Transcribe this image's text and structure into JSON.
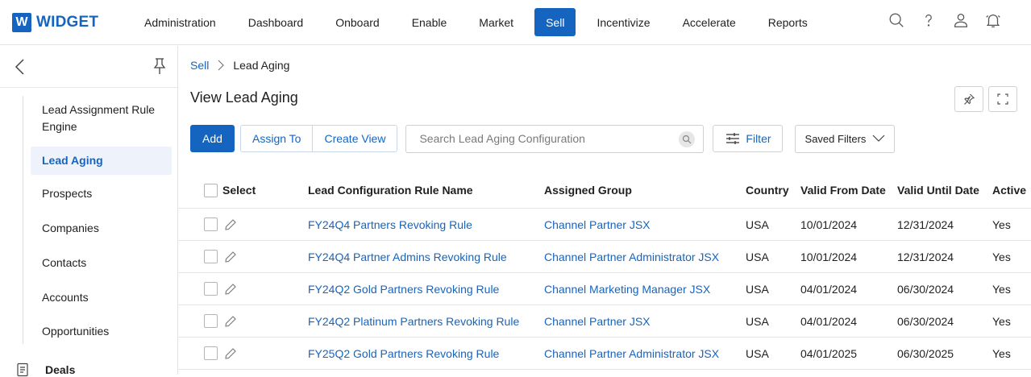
{
  "app": {
    "logo_letter": "W",
    "logo_text": "WIDGET"
  },
  "nav": {
    "items": [
      {
        "label": "Administration"
      },
      {
        "label": "Dashboard"
      },
      {
        "label": "Onboard"
      },
      {
        "label": "Enable"
      },
      {
        "label": "Market"
      },
      {
        "label": "Sell",
        "active": true
      },
      {
        "label": "Incentivize"
      },
      {
        "label": "Accelerate"
      },
      {
        "label": "Reports"
      }
    ],
    "icons": [
      "search-icon",
      "help-icon",
      "user-icon",
      "bell-icon"
    ]
  },
  "sidebar": {
    "items": [
      {
        "label": "Lead Assignment Rule Engine"
      },
      {
        "label": "Lead Aging",
        "active": true
      },
      {
        "label": "Prospects"
      },
      {
        "label": "Companies"
      },
      {
        "label": "Contacts"
      },
      {
        "label": "Accounts"
      },
      {
        "label": "Opportunities"
      }
    ],
    "deals_label": "Deals"
  },
  "breadcrumb": {
    "parent": "Sell",
    "current": "Lead Aging"
  },
  "page": {
    "title": "View Lead Aging"
  },
  "toolbar": {
    "add_label": "Add",
    "assign_label": "Assign To",
    "create_view_label": "Create View",
    "search_placeholder": "Search Lead Aging Configuration",
    "filter_label": "Filter",
    "saved_filters_label": "Saved Filters"
  },
  "table": {
    "headers": {
      "select": "Select",
      "name": "Lead Configuration Rule Name",
      "group": "Assigned Group",
      "country": "Country",
      "from": "Valid From Date",
      "until": "Valid Until Date",
      "active": "Active"
    },
    "rows": [
      {
        "name": "FY24Q4 Partners Revoking Rule",
        "group": "Channel Partner JSX",
        "country": "USA",
        "from": "10/01/2024",
        "until": "12/31/2024",
        "active": "Yes"
      },
      {
        "name": "FY24Q4 Partner Admins Revoking Rule",
        "group": "Channel Partner Administrator JSX",
        "country": "USA",
        "from": "10/01/2024",
        "until": "12/31/2024",
        "active": "Yes"
      },
      {
        "name": "FY24Q2 Gold Partners Revoking Rule",
        "group": "Channel Marketing Manager JSX",
        "country": "USA",
        "from": "04/01/2024",
        "until": "06/30/2024",
        "active": "Yes"
      },
      {
        "name": "FY24Q2 Platinum Partners Revoking Rule",
        "group": "Channel Partner JSX",
        "country": "USA",
        "from": "04/01/2024",
        "until": "06/30/2024",
        "active": "Yes"
      },
      {
        "name": "FY25Q2 Gold Partners Revoking Rule",
        "group": "Channel Partner Administrator JSX",
        "country": "USA",
        "from": "04/01/2025",
        "until": "06/30/2025",
        "active": "Yes"
      }
    ]
  },
  "colors": {
    "brand": "#1565c0",
    "active_bg": "#eef3fb"
  }
}
